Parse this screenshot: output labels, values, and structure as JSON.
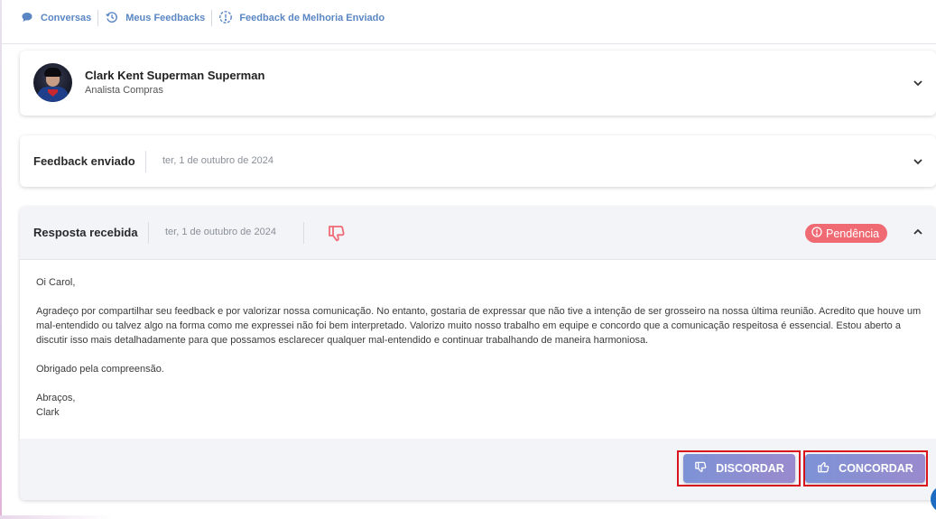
{
  "breadcrumb": {
    "items": [
      {
        "label": "Conversas",
        "icon": "chat-bubble-icon"
      },
      {
        "label": "Meus Feedbacks",
        "icon": "history-icon"
      },
      {
        "label": "Feedback de Melhoria Enviado",
        "icon": "alert-circle-icon"
      }
    ]
  },
  "profile": {
    "name": "Clark Kent Superman Superman",
    "role": "Analista Compras"
  },
  "feedback_sent": {
    "title": "Feedback enviado",
    "date": "ter, 1 de outubro de 2024"
  },
  "response": {
    "title": "Resposta recebida",
    "date": "ter, 1 de outubro de 2024",
    "reaction_icon": "thumbs-down-icon",
    "status_badge": "Pendência",
    "status_color": "#f06a73",
    "message": {
      "greeting": "Oi Carol,",
      "body": "Agradeço por compartilhar seu feedback e por valorizar nossa comunicação. No entanto, gostaria de expressar que não tive a intenção de ser grosseiro na nossa última reunião. Acredito que houve um mal-entendido ou talvez algo na forma como me expressei não foi bem interpretado. Valorizo muito nosso trabalho em equipe e concordo que a comunicação respeitosa é essencial. Estou aberto a discutir isso mais detalhadamente para que possamos esclarecer qualquer mal-entendido e continuar trabalhando de maneira harmoniosa.",
      "thanks": "Obrigado pela compreensão.",
      "closing": "Abraços,",
      "signature": "Clark"
    }
  },
  "actions": {
    "disagree_label": "DISCORDAR",
    "agree_label": "CONCORDAR"
  },
  "colors": {
    "accent": "#5a86c3",
    "button_gradient_start": "#7d93d6",
    "button_gradient_end": "#9a8acd",
    "highlight_frame": "#d9151d"
  }
}
